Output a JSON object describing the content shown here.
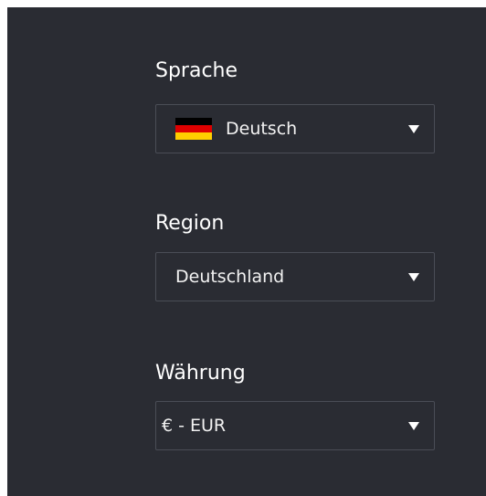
{
  "language": {
    "label": "Sprache",
    "selected": "Deutsch",
    "flag_colors": [
      "#000000",
      "#dd0000",
      "#ffce00"
    ],
    "caret_icon": "chevron-down-icon"
  },
  "region": {
    "label": "Region",
    "selected": "Deutschland",
    "caret_icon": "chevron-down-icon"
  },
  "currency": {
    "label": "Währung",
    "selected": "€ - EUR",
    "caret_icon": "chevron-down-icon"
  },
  "colors": {
    "panel_background": "#2a2c33",
    "text": "#ffffff",
    "border": "#4a4d56"
  }
}
